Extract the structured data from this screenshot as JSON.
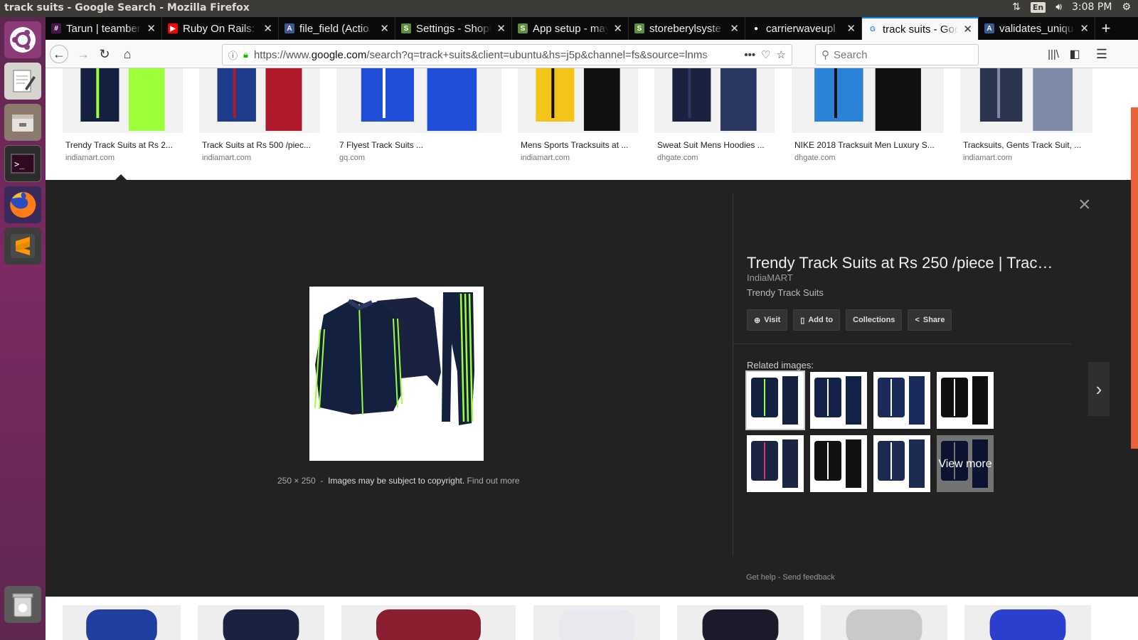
{
  "window": {
    "title": "track suits - Google Search - Mozilla Firefox",
    "keyboard": "En",
    "time": "3:08 PM"
  },
  "launcher": [
    "ubuntu-dash-icon",
    "text-editor-icon",
    "file-manager-icon",
    "terminal-icon",
    "firefox-icon",
    "sublime-text-icon",
    "trash-icon"
  ],
  "tabs": [
    {
      "title": "Tarun | teamber",
      "favicon": "slack",
      "color": "#4a154b"
    },
    {
      "title": "Ruby On Rails: N",
      "favicon": "youtube",
      "color": "#ff0000"
    },
    {
      "title": "file_field (Actio",
      "favicon": "A",
      "color": "#3b5998"
    },
    {
      "title": "Settings - Shopi",
      "favicon": "shopify",
      "color": "#5e8e3e"
    },
    {
      "title": "App setup - may",
      "favicon": "shopify",
      "color": "#5e8e3e"
    },
    {
      "title": "storeberylsyste",
      "favicon": "shopify",
      "color": "#5e8e3e"
    },
    {
      "title": "carrierwaveupl",
      "favicon": "github",
      "color": "#ffffff"
    },
    {
      "title": "track suits - Goo",
      "favicon": "G",
      "color": "#4285f4",
      "active": true
    },
    {
      "title": "validates_uniqu",
      "favicon": "A",
      "color": "#3b5998"
    }
  ],
  "nav": {
    "url_prefix": "https://www.",
    "url_domain": "google.com",
    "url_rest": "/search?q=track+suits&client=ubuntu&hs=j5p&channel=fs&source=lnms",
    "search_placeholder": "Search"
  },
  "results": [
    {
      "caption": "Trendy Track Suits at Rs 2...",
      "source": "indiamart.com"
    },
    {
      "caption": "Track Suits at Rs 500 /piec...",
      "source": "indiamart.com"
    },
    {
      "caption": "7 Flyest Track Suits ...",
      "source": "gq.com"
    },
    {
      "caption": "Mens Sports Tracksuits at ...",
      "source": "indiamart.com"
    },
    {
      "caption": "Sweat Suit Mens Hoodies ...",
      "source": "dhgate.com"
    },
    {
      "caption": "NIKE 2018 Tracksuit Men Luxury S...",
      "source": "dhgate.com"
    },
    {
      "caption": "Tracksuits, Gents Track Suit, ...",
      "source": "indiamart.com"
    }
  ],
  "preview": {
    "title": "Trendy Track Suits at Rs 250 /piece | Track ...",
    "site": "IndiaMART",
    "description": "Trendy Track Suits",
    "dimensions": "250 × 250",
    "separator": "-",
    "copyright": "Images may be subject to copyright.",
    "find_out_more": "Find out more",
    "buttons": {
      "visit": "Visit",
      "add_to": "Add to",
      "collections": "Collections",
      "share": "Share"
    },
    "related_heading": "Related images:",
    "view_more": "View more",
    "get_help": "Get help",
    "send_feedback": "Send feedback",
    "close_glyph": "×"
  },
  "colors": {
    "accent_tab": "#0a84ff",
    "panel_bg": "#222222",
    "scrollbar": "#e8623a",
    "launcher": "#5e2750"
  }
}
